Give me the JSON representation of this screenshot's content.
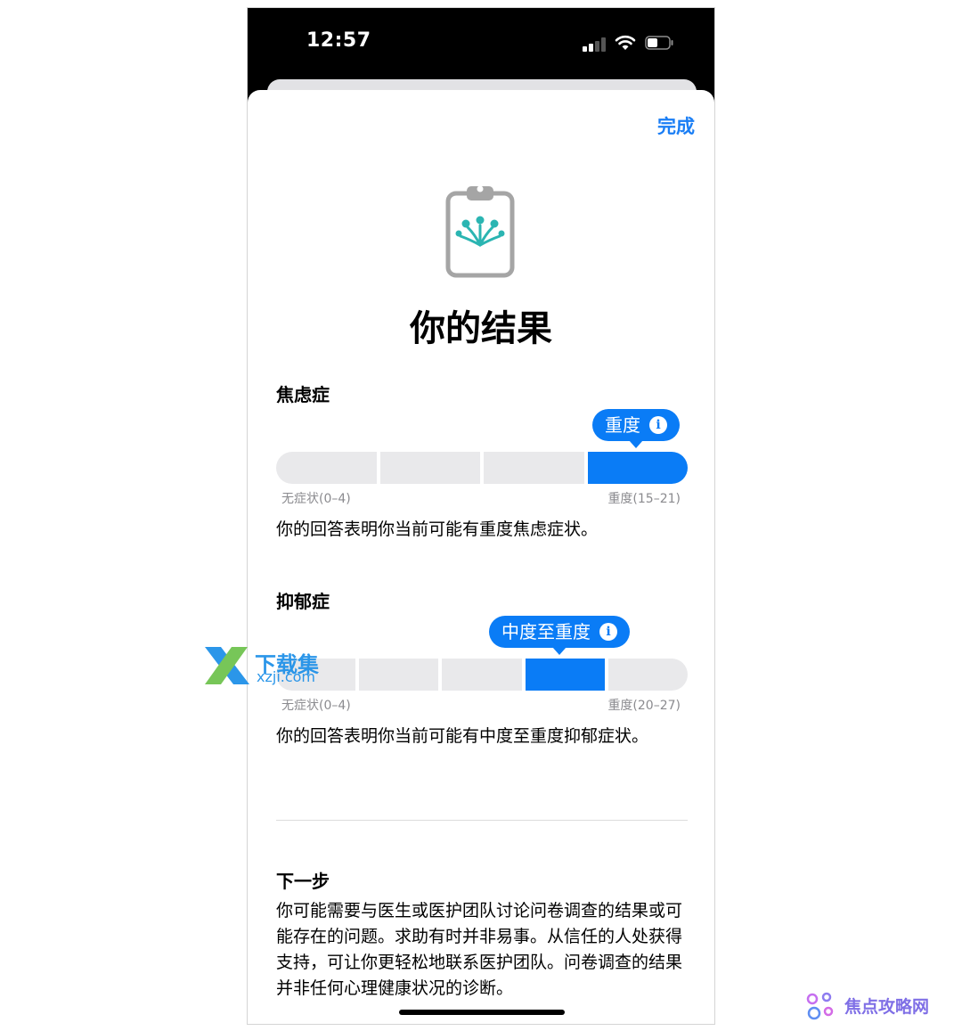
{
  "status_bar": {
    "time": "12:57"
  },
  "header": {
    "done_label": "完成"
  },
  "page": {
    "title": "你的结果"
  },
  "anxiety": {
    "title": "焦虑症",
    "level_label": "重度",
    "active_segment": 4,
    "segment_count": 4,
    "min_label": "无症状(0–4)",
    "max_label": "重度(15–21)",
    "description": "你的回答表明你当前可能有重度焦虑症状。"
  },
  "depression": {
    "title": "抑郁症",
    "level_label": "中度至重度",
    "active_segment": 4,
    "segment_count": 5,
    "min_label": "无症状(0–4)",
    "max_label": "重度(20–27)",
    "description": "你的回答表明你当前可能有中度至重度抑郁症状。"
  },
  "next_steps": {
    "title": "下一步",
    "body": "你可能需要与医生或医护团队讨论问卷调查的结果或可能存在的问题。求助有时并非易事。从信任的人处获得支持，可让你更轻松地联系医护团队。问卷调查的结果并非任何心理健康状况的诊断。"
  },
  "icons": {
    "info": "info-icon",
    "clipboard": "clipboard-icon",
    "signal": "cellular-signal-icon",
    "wifi": "wifi-icon",
    "battery": "battery-icon"
  },
  "colors": {
    "accent": "#0a7cf6",
    "done": "#1a7ef5",
    "segment_inactive": "#e9e9eb",
    "icon_teal": "#2bb5b2"
  },
  "watermarks": {
    "left": {
      "title": "下载集",
      "url": "xzji.com"
    },
    "right": {
      "title": "焦点攻略网"
    }
  }
}
